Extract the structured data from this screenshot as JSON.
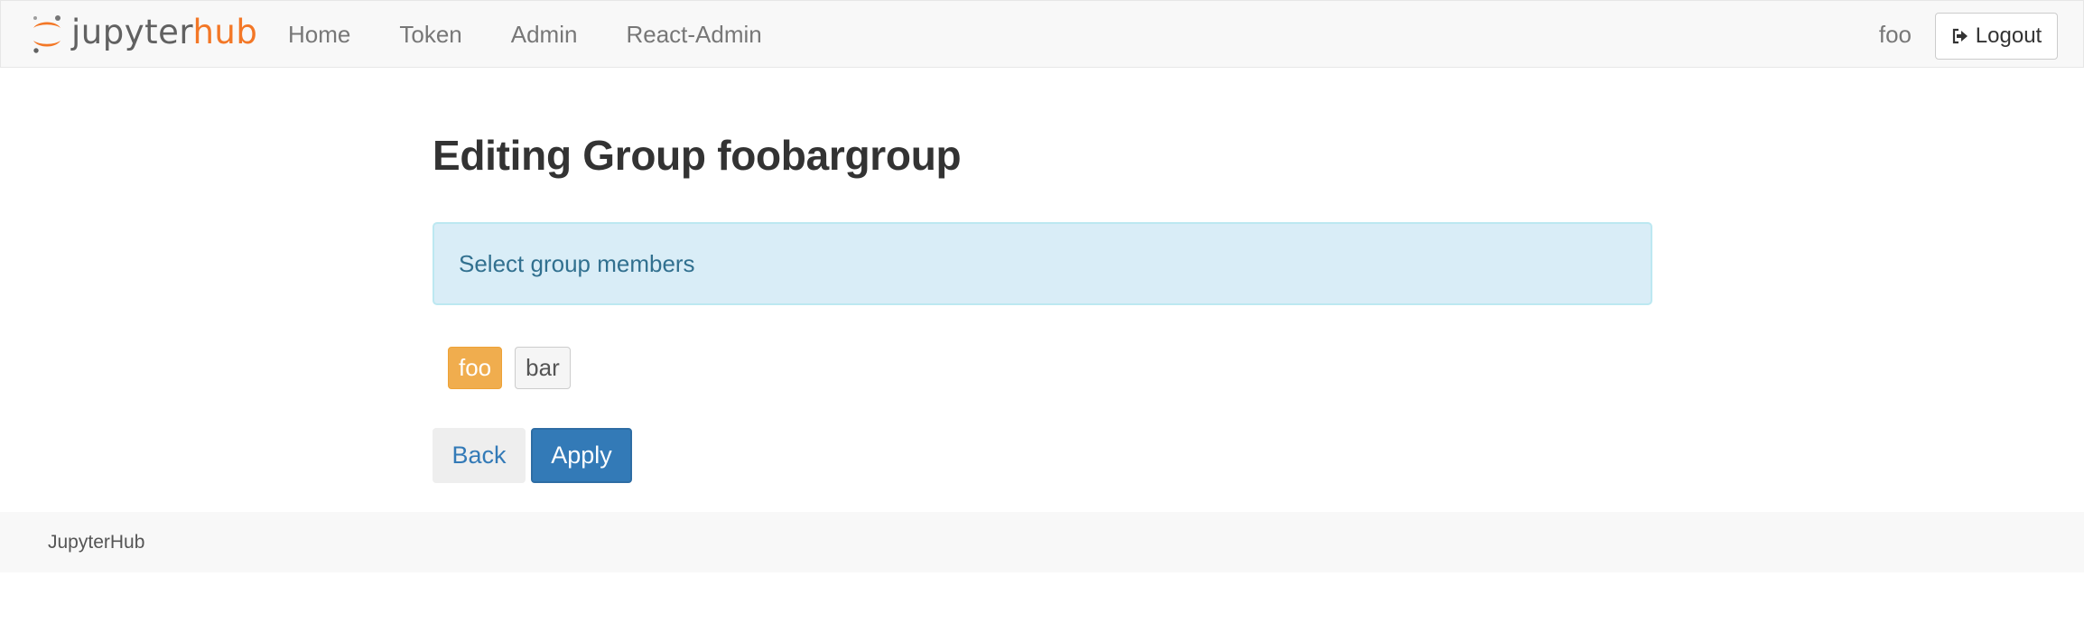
{
  "navbar": {
    "brand": {
      "word_left": "jupyter",
      "word_right": "hub",
      "logo_icon": "jupyter-logo-icon"
    },
    "links": [
      {
        "label": "Home"
      },
      {
        "label": "Token"
      },
      {
        "label": "Admin"
      },
      {
        "label": "React-Admin"
      }
    ],
    "user": "foo",
    "logout": {
      "label": "Logout",
      "icon": "sign-out-icon"
    }
  },
  "main": {
    "title": "Editing Group foobargroup",
    "alert_text": "Select group members",
    "members": [
      {
        "name": "foo",
        "selected": true
      },
      {
        "name": "bar",
        "selected": false
      }
    ],
    "back_label": "Back",
    "apply_label": "Apply"
  },
  "footer": {
    "text": "JupyterHub"
  },
  "colors": {
    "brand_orange": "#f37726",
    "selected_member": "#f0ad4e",
    "primary": "#337ab7",
    "alert_bg": "#d9edf7"
  }
}
